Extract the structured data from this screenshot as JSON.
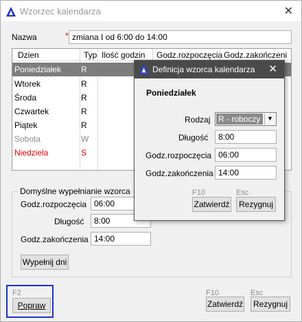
{
  "window": {
    "title": "Wzorzec kalendarza",
    "close": "✕"
  },
  "form": {
    "name_label": "Nazwa",
    "required_mark": "*",
    "name_value": "zmiana I od 6:00 do 14:00"
  },
  "grid": {
    "columns": [
      "Dzien",
      "Typ",
      "Ilość godzin",
      "Godz.rozpoczęcia",
      "Godz.zakończeni"
    ],
    "rows": [
      {
        "day": "Poniedziałek",
        "type": "R",
        "selected": true
      },
      {
        "day": "Wtorek",
        "type": "R"
      },
      {
        "day": "Środa",
        "type": "R"
      },
      {
        "day": "Czwartek",
        "type": "R"
      },
      {
        "day": "Piątek",
        "type": "R"
      },
      {
        "day": "Sobota",
        "type": "W",
        "color": "#8a8a8a"
      },
      {
        "day": "Niedziela",
        "type": "S",
        "color": "#e00000"
      }
    ]
  },
  "defaults": {
    "group_title": "Domyślne wypełnianie wzorca",
    "start_label": "Godz.rozpoczęcia",
    "start_value": "06:00",
    "length_label": "Długość",
    "length_value": "8:00",
    "end_label": "Godz.zakończenia",
    "end_value": "14:00",
    "fill_button": "Wypełnij dni"
  },
  "footer": {
    "edit_key": "F2",
    "edit_button": "Popraw",
    "confirm_key": "F10",
    "confirm_button": "Zatwierdź",
    "cancel_key": "Esc",
    "cancel_button": "Rezygnuj"
  },
  "dialog": {
    "title": "Definicja wzorca kalendarza",
    "close": "✕",
    "heading": "Poniedziałek",
    "type_label": "Rodzaj",
    "type_value": "R - roboczy",
    "length_label": "Długość",
    "length_value": "8:00",
    "start_label": "Godz.rozpoczęcia",
    "start_value": "06:00",
    "end_label": "Godz.zakończenia",
    "end_value": "14:00",
    "confirm_key": "F10",
    "confirm_button": "Zatwierdź",
    "cancel_key": "Esc",
    "cancel_button": "Rezygnuj"
  },
  "colors": {
    "selection": "#7d7d7d",
    "focus": "#1b33c8",
    "required": "#e00000",
    "dialog_title": "#4a4a4a"
  }
}
